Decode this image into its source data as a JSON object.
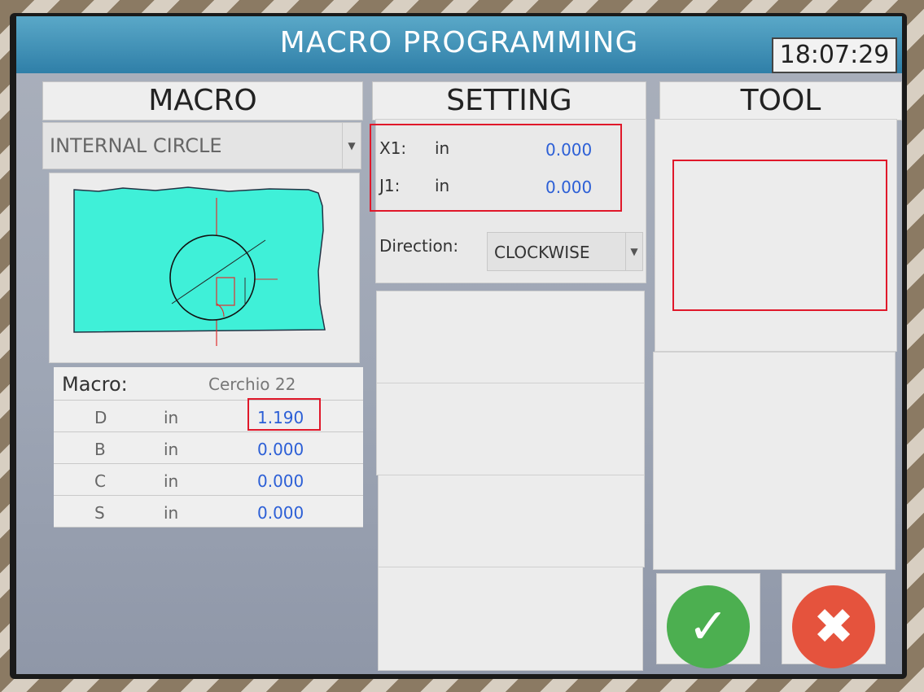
{
  "window": {
    "title": "MACRO PROGRAMMING",
    "clock": "18:07:29"
  },
  "macro": {
    "header": "MACRO",
    "selected": "INTERNAL CIRCLE",
    "table": {
      "label": "Macro:",
      "name": "Cerchio 22",
      "rows": [
        {
          "param": "D",
          "unit": "in",
          "value": "1.190"
        },
        {
          "param": "B",
          "unit": "in",
          "value": "0.000"
        },
        {
          "param": "C",
          "unit": "in",
          "value": "0.000"
        },
        {
          "param": "S",
          "unit": "in",
          "value": "0.000"
        }
      ]
    }
  },
  "setting": {
    "header": "SETTING",
    "x1": {
      "label": "X1:",
      "unit": "in",
      "value": "0.000"
    },
    "j1": {
      "label": "J1:",
      "unit": "in",
      "value": "0.000"
    },
    "direction": {
      "label": "Direction:",
      "value": "CLOCKWISE"
    }
  },
  "tool": {
    "header": "TOOL"
  },
  "colors": {
    "accent": "#2f7fa8",
    "value_text": "#2c5fd6",
    "highlight": "#e0182a",
    "confirm": "#4caf50",
    "cancel": "#e5533d"
  }
}
